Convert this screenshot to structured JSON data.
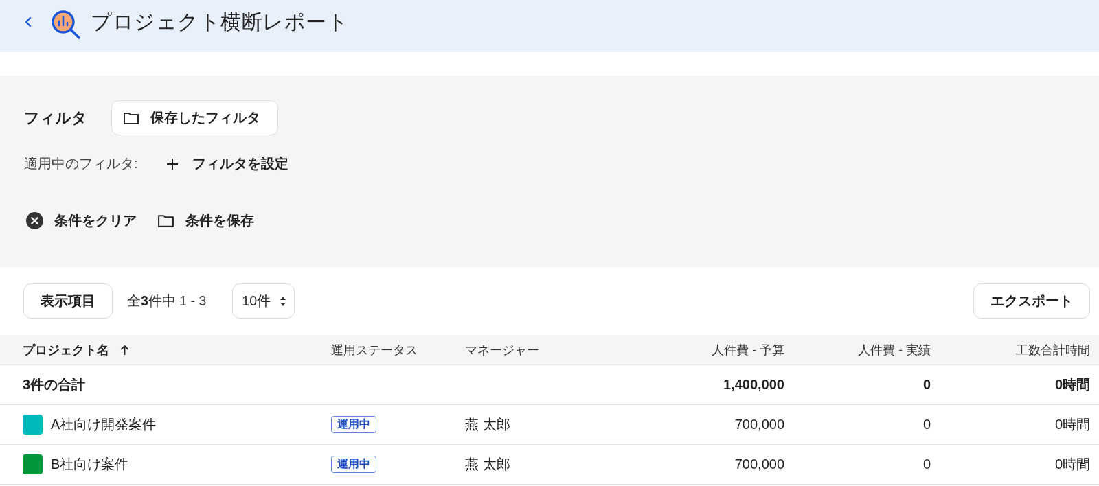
{
  "header": {
    "title": "プロジェクト横断レポート"
  },
  "filter_panel": {
    "label": "フィルタ",
    "saved_filters_button": "保存したフィルタ",
    "applied_label": "適用中のフィルタ:",
    "add_filter_button": "フィルタを設定",
    "clear_button": "条件をクリア",
    "save_button": "条件を保存"
  },
  "toolbar": {
    "columns_button": "表示項目",
    "count": "全**3**件中 1 - 3",
    "page_size": "10件",
    "export_button": "エクスポート"
  },
  "table": {
    "columns": [
      {
        "label": "プロジェクト名",
        "kind": "text",
        "sorted": true
      },
      {
        "label": "運用ステータス",
        "kind": "text",
        "sorted": false
      },
      {
        "label": "マネージャー",
        "kind": "text",
        "sorted": false
      },
      {
        "label": "人件費 - 予算",
        "kind": "number",
        "sorted": false
      },
      {
        "label": "人件費 - 実績",
        "kind": "number",
        "sorted": false
      },
      {
        "label": "工数合計時間",
        "kind": "number",
        "sorted": false
      }
    ],
    "total_row": {
      "label": "3件の合計",
      "labor_budget": "1,400,000",
      "labor_actual": "0",
      "hours": "0時間"
    },
    "rows": [
      {
        "name": "A社向け開発案件",
        "color": "#00b9b9",
        "status": "運用中",
        "manager": "燕 太郎",
        "labor_budget": "700,000",
        "labor_actual": "0",
        "hours": "0時間"
      },
      {
        "name": "B社向け案件",
        "color": "#00973a",
        "status": "運用中",
        "manager": "燕 太郎",
        "labor_budget": "700,000",
        "labor_actual": "0",
        "hours": "0時間"
      }
    ]
  }
}
